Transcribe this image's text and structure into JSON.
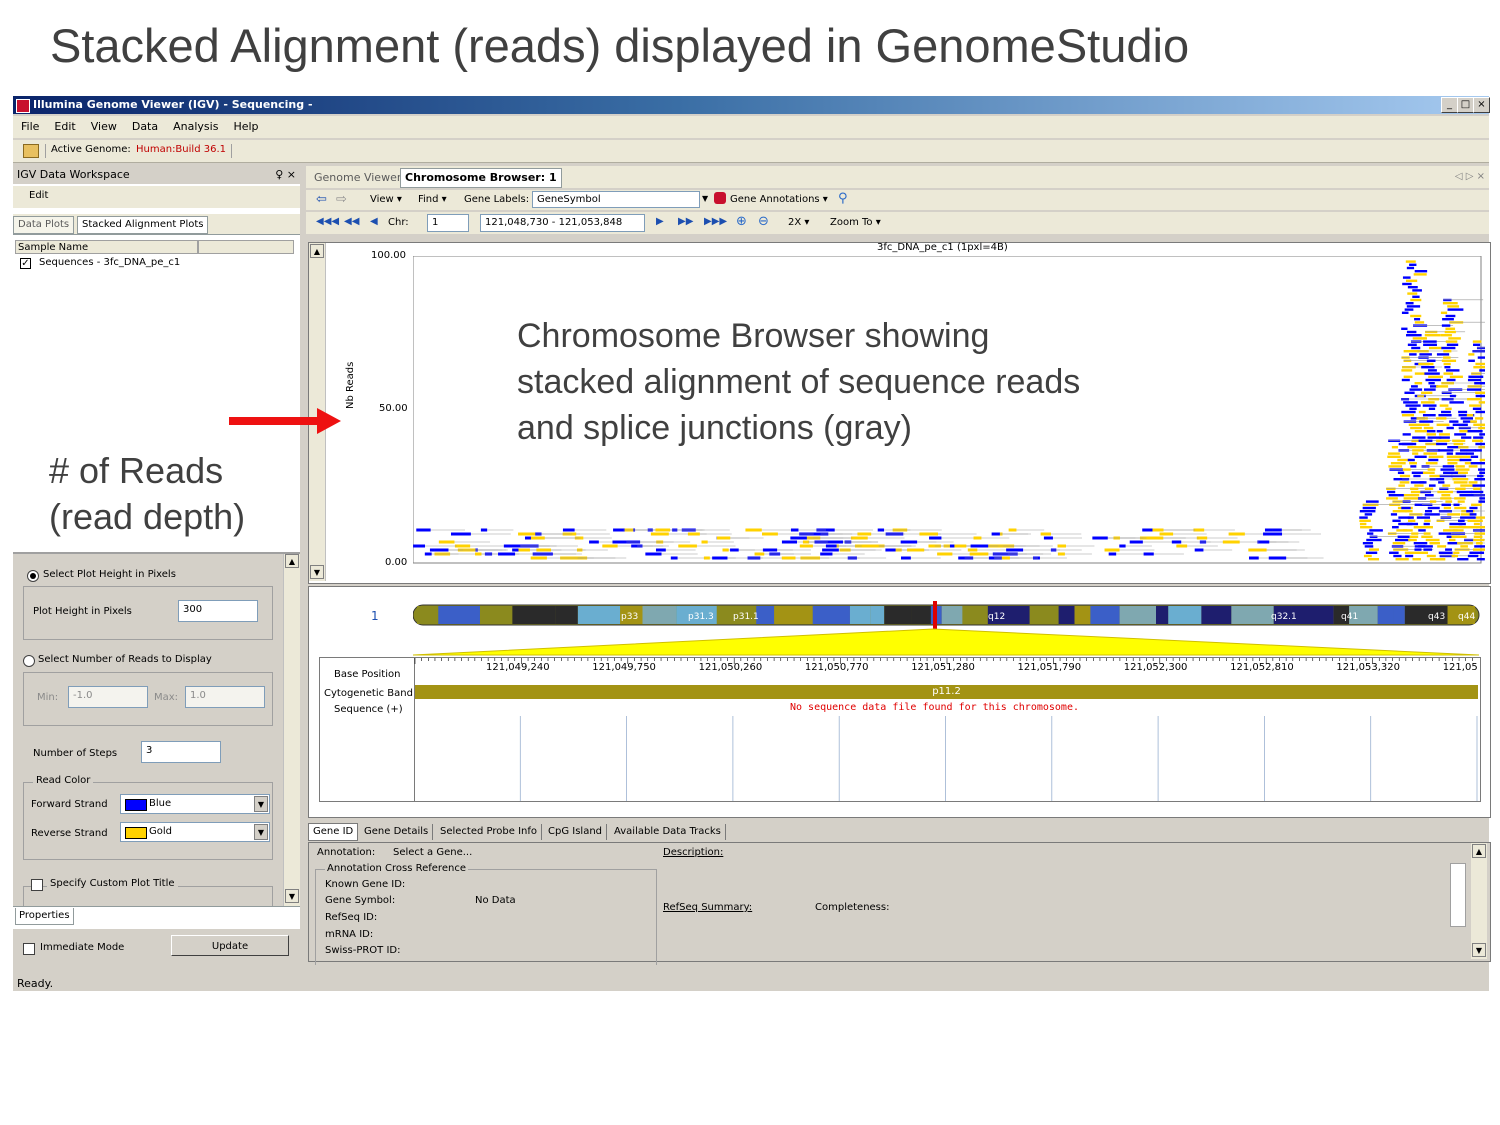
{
  "slide": {
    "title": "Stacked Alignment (reads) displayed in GenomeStudio",
    "annotation_reads": [
      "# of Reads",
      "(read depth)"
    ],
    "annotation_browser": [
      "Chromosome Browser showing",
      "stacked alignment of sequence reads",
      "and splice junctions (gray)"
    ]
  },
  "window": {
    "title": "Illumina Genome Viewer (IGV) - Sequencing -",
    "minimize": "_",
    "maximize": "□",
    "close": "×"
  },
  "menu": [
    "File",
    "Edit",
    "View",
    "Data",
    "Analysis",
    "Help"
  ],
  "toolbar": {
    "genome_label": "Active Genome:",
    "genome_value": "Human:Build 36.1"
  },
  "workspace": {
    "title": "IGV Data Workspace",
    "pin": "♀ ×",
    "edit": "Edit",
    "tabs": [
      "Data Plots",
      "Stacked Alignment Plots"
    ],
    "column_header": "Sample Name",
    "sample": "Sequences - 3fc_DNA_pe_c1"
  },
  "properties": {
    "opt_height": "Select Plot Height in Pixels",
    "height_label": "Plot Height in Pixels",
    "height_value": "300",
    "opt_reads": "Select Number of Reads to Display",
    "min_label": "Min:",
    "min_value": "-1.0",
    "max_label": "Max:",
    "max_value": "1.0",
    "steps_label": "Number of Steps",
    "steps_value": "3",
    "read_color": "Read Color",
    "fwd_label": "Forward Strand",
    "fwd_value": "Blue",
    "rev_label": "Reverse Strand",
    "rev_value": "Gold",
    "custom_title": "Specify Custom Plot Title",
    "tab": "Properties",
    "immediate": "Immediate Mode",
    "update": "Update",
    "colors": {
      "forward": "#0000ff",
      "reverse": "#ffd200"
    }
  },
  "browser": {
    "tabs": [
      "Genome Viewer",
      "Chromosome Browser: 1"
    ],
    "view": "View",
    "find": "Find",
    "gene_labels": "Gene Labels:",
    "gene_labels_value": "GeneSymbol",
    "gene_annotations": "Gene Annotations",
    "chr_label": "Chr:",
    "chr_value": "1",
    "position": "121,048,730 - 121,053,848",
    "zoom2x": "2X",
    "zoom_to": "Zoom To",
    "plot_title": "3fc_DNA_pe_c1 (1pxl=4B)",
    "ylabel": "Nb Reads",
    "yticks": [
      "100.00",
      "50.00",
      "0.00"
    ],
    "chr_number": "1",
    "bands": [
      "p33",
      "p31.3",
      "p31.1",
      "q12",
      "q32.1",
      "q41",
      "q43",
      "q44"
    ],
    "base_position_label": "Base Position",
    "base_positions": [
      "121,049,240",
      "121,049,750",
      "121,050,260",
      "121,050,770",
      "121,051,280",
      "121,051,790",
      "121,052,300",
      "121,052,810",
      "121,053,320",
      "121,05"
    ],
    "cyto_label": "Cytogenetic Band",
    "cyto_value": "p11.2",
    "seq_label": "Sequence (+)",
    "seq_msg": "No sequence data file found for this chromosome."
  },
  "bottom": {
    "tabs": [
      "Gene ID",
      "Gene Details",
      "Selected Probe Info",
      "CpG Island",
      "Available Data Tracks"
    ],
    "annotation": "Annotation:",
    "select_gene": "Select a Gene...",
    "cross_ref": "Annotation Cross Reference",
    "known_gene": "Known Gene ID:",
    "gene_symbol": "Gene Symbol:",
    "no_data": "No Data",
    "refseq": "RefSeq ID:",
    "mrna": "mRNA ID:",
    "swiss": "Swiss-PROT ID:",
    "description": "Description:",
    "refseq_summary": "RefSeq Summary:",
    "completeness": "Completeness:"
  },
  "status": "Ready."
}
